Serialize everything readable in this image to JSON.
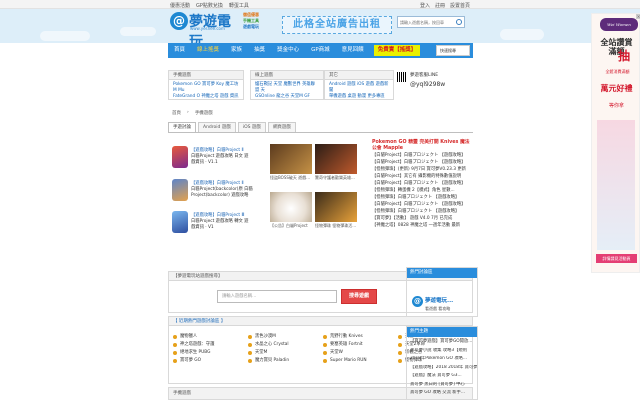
{
  "topbar": {
    "left": [
      "優惠活動",
      "GP點數兌換",
      "轉蛋工具"
    ],
    "right": [
      "登入",
      "註冊",
      "設置首頁"
    ]
  },
  "header": {
    "logo_glyph": "@",
    "logo_title": "夢遊電玩",
    "logo_sub": "www.yeshee.com",
    "promo_lines": [
      "儲值優惠",
      "手機工具",
      "遊戲電玩"
    ],
    "ad_banner": "此格全站廣告出租",
    "search_placeholder": "請輸入遊戲名稱，按回車"
  },
  "nav": {
    "items": [
      "首頁",
      "線上搖獎",
      "家族",
      "抽獎",
      "獎金中心",
      "GP商城",
      "意見回饋"
    ],
    "hot": "免費賣【搖獎】",
    "select": "快速搜尋"
  },
  "info_boxes": {
    "box1_title": "手機遊戲",
    "box1_lines": [
      "Pokemon GO 寶可夢 Koy 魔工坊 M Mu",
      "FateGrand O 神魔之塔 遊戲 資訊"
    ],
    "box2_title": "線上遊戲",
    "box2_lines": [
      "爐石戰記 天堂 魔獸世界 英雄聯盟 天",
      "GSOnline 龍之谷 天堂M GF"
    ],
    "box3_title": "其它",
    "box3_lines": [
      "Android 遊戲 iOS 遊戲 遊戲新聞",
      "單機遊戲 桌遊 動漫 更多專區"
    ],
    "line_title": "夢遊客服LINE",
    "line_id": "@yql9298w"
  },
  "breadcrumb": [
    "首頁",
    "手機遊戲"
  ],
  "tabs": [
    "手遊討論",
    "Android 遊戲",
    "iOS 遊戲",
    "網頁遊戲"
  ],
  "cards": [
    {
      "title": "【遊戲攻略】白貓Project Ⅱ",
      "lines": [
        "白貓Project 遊戲攻略 日文 遊",
        "戲資訊 · V1.1"
      ],
      "color": "#c73434"
    },
    {
      "title": "【遊戲攻略】白貓Project Ⅱ",
      "lines": [
        "白貓Project(backcolor)原 白貓",
        "Project(backcolor) 遊戲攻略"
      ],
      "color": "#5d84c9"
    },
    {
      "title": "【遊戲攻略】白貓Project Ⅲ",
      "lines": [
        "白貓Project 遊戲攻略 轉文 遊",
        "戲資訊 · V1"
      ],
      "color": "#4e8fd4"
    }
  ],
  "pics": [
    {
      "caption": "怪盜BOSS破天 遊戲...",
      "color": "#9b6a2d"
    },
    {
      "caption": "驚奇守護者歡樂英雄...",
      "color": "#b0432b"
    },
    {
      "caption": "【公告】白貓Project",
      "color": "#d8c2a4"
    },
    {
      "caption": "怪物彈珠 怪物彈珠活...",
      "color": "#cf8c2a"
    }
  ],
  "news": {
    "title": "Pokemon GO 精靈 完美打開 Knives 魔法公會 Mapple",
    "rows": [
      "【白貓Project】白貓プロジェクト 【遊戲攻略】",
      "【白貓Project】白貓プロジェクト 【遊戲攻略】",
      "【怪物彈珠】(更新) 9月7日 寶可夢V0.23.3 更新",
      "【白貓Project】其它有 攝影機的特殊數值說明",
      "【白貓Project】白貓プロジェクト 【遊戲攻略】",
      "【怪物彈珠】轉蛋機 2【模式】角色 星數...",
      "【怪物彈珠】白貓プロジェクト 【遊戲攻略】",
      "【白貓Project】白貓プロジェクト 【遊戲攻略】",
      "【怪物彈珠】白貓プロジェクト 【遊戲攻略】",
      "【寶可夢】【活動】 遊戲 V4.0 7月 已完成",
      "【神魔之塔】0828 神魔之塔 一週年活動 最新"
    ]
  },
  "search2": {
    "title": "【夢遊電玩站遊戲搜尋】",
    "placeholder": "請輸入遊戲名稱...",
    "button": "搜尋遊戲"
  },
  "platform": {
    "title": "【 近期熱門遊戲討論區 】",
    "items": [
      "魔物獵人",
      "黑色沙漠M",
      "荒野行動 Knives",
      "天堂II M",
      "神之塔遊戲：守護",
      "水晶之心 Crystal",
      "要塞英雄 Fortnit",
      "天堂2革命",
      "絕地求生 PUBG",
      "天堂M",
      "天堂W",
      "新楓之谷",
      "寶可夢 GO",
      "魔力寶貝 Paladin",
      "Super Mario RUN",
      "怪物彈珠"
    ]
  },
  "footer_left": "手機遊戲",
  "right": {
    "sec1_title": "熱門討論區",
    "sec1_logo_glyph": "@",
    "sec1_logo": "夢遊電玩...",
    "sec1_sub": "看遊戲 看攻略",
    "sec2_title": "熱門主題",
    "sec2_lines": [
      "【寶可夢遊戲】寶可夢GO開放...",
      "寶可夢小說 收集 攻略3【規則",
      "2018年Pokemon GO 攻略...",
      "【遊戲攻略】2018 2018年 寶可夢",
      "【遊戲】魔法 寶可夢 G3...",
      "寶可夢 黑白的 [寶可夢] 中心",
      "寶可夢 GO 攻略 交流 新手..."
    ]
  },
  "sidead": {
    "seal": "Wei Women",
    "line1": "全站讚賞",
    "line1b": "滿額",
    "big": "抽",
    "small": "全館消費滿額",
    "line2": "萬元好禮",
    "line2b": "等你拿",
    "line3": "詳情請見活動頁",
    "close": "×"
  },
  "colors": {
    "nav_blue": "#2a8ddc",
    "accent_red": "#d62b2b",
    "header_bg": "#ddeef9"
  }
}
